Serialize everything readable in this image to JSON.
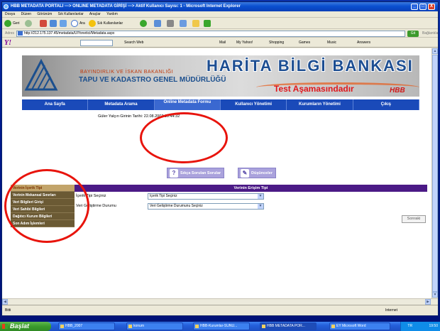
{
  "window": {
    "title": "HBB METADATA PORTALI ---> ONLINE METADATA GİRİŞİ ---> Aktif Kullanıcı Sayısı: 1 - Microsoft Internet Explorer",
    "min": "_",
    "max": "□",
    "close": "X"
  },
  "menu": [
    "Dosya",
    "Düzen",
    "Görünüm",
    "Sık Kullanılanlar",
    "Araçlar",
    "Yardım"
  ],
  "toolbar": {
    "back": "Geri",
    "search": "Ara",
    "favorites": "Sık Kullanılanlar"
  },
  "address": {
    "label": "Adres",
    "url": "http://212.175.137.45/metadata/UIYonetici/Metadata.aspx",
    "go": "Git",
    "links": "Bağlantılar"
  },
  "yahoo": {
    "logo": "Y!",
    "search_web": "Search Web",
    "mail": "Mail",
    "my_yahoo": "My Yahoo!",
    "shopping": "Shopping",
    "games": "Games",
    "music": "Music",
    "answers": "Answers"
  },
  "banner": {
    "sub1": "BAYINDIRLIK VE İSKAN BAKANLIĞI",
    "sub2": "TAPU VE KADASTRO GENEL MÜDÜRLÜĞÜ",
    "title": "HARİTA BİLGİ BANKASI",
    "test": "Test Aşamasındadır",
    "hbb": "HBB"
  },
  "nav": [
    {
      "label": "Ana Sayfa"
    },
    {
      "label": "Metadata Arama"
    },
    {
      "label": "Online Metadata Formu"
    },
    {
      "label": "Kullanıcı Yönetimi"
    },
    {
      "label": "Kurumların Yönetimi"
    },
    {
      "label": "Çıkış"
    }
  ],
  "login_info": "Güler Yalçın Girinin Tarihi: 22.08.2007 19:44:32",
  "help": {
    "faq": "Sıkça Sorulan Sorular",
    "notes": "Düşünceler"
  },
  "left_menu": [
    "Verinin İçerik Tipi",
    "Verinin Mekansal Sınırları",
    "Veri Bilgileri Girişi",
    "Veri Sahibi Bilgileri",
    "Dağıtıcı Kurum Bilgileri",
    "Son Adım İşlemleri"
  ],
  "form": {
    "header": "Verinin Erişim Tipi",
    "content_type_label": "İçerik Tipi Seçiniz",
    "content_type_value": "İçerik Tipi Seçiniz",
    "dev_status_label": "Veri Geliştirme Durumu",
    "dev_status_value": "Veri Geliştirme Durumunu Seçiniz",
    "next": "Sonraki"
  },
  "status": {
    "left": "Bitti",
    "zone": "Internet"
  },
  "taskbar": {
    "start": "Başlat",
    "items": [
      "HBB_2007",
      "konum",
      "HBB-Kurumlar-SUNU...",
      "HBB METADATA POR...",
      "EY Microsoft Word"
    ],
    "tray_lang": "TR",
    "clock": "19:50"
  },
  "colors": {
    "nav_blue": "#1a4ab9",
    "form_header_purple": "#4b1a86",
    "left_menu_brown": "#6b5a34",
    "annotation_red": "#e8140c"
  }
}
